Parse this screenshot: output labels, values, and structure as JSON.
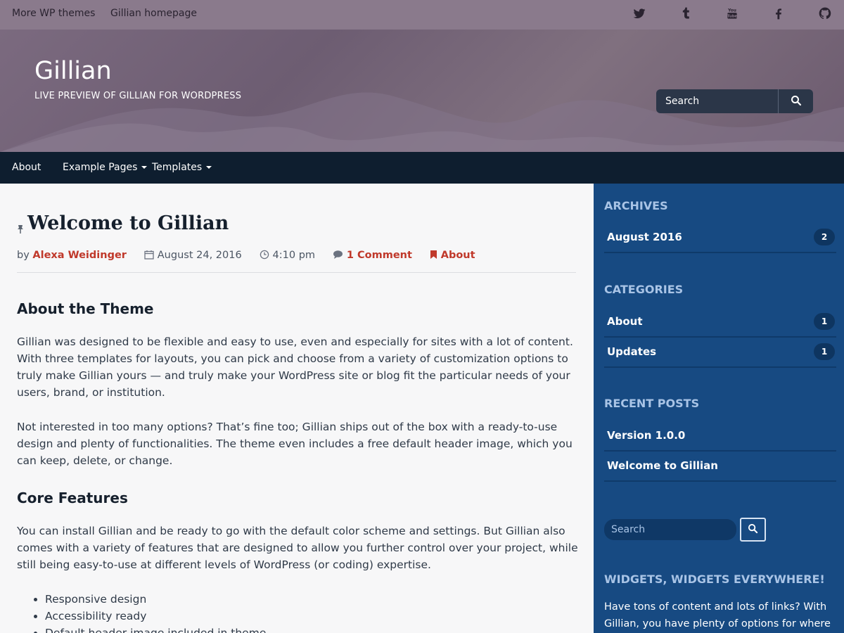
{
  "topbar": {
    "links": [
      "More WP themes",
      "Gillian homepage"
    ],
    "social_icons": [
      "twitter-icon",
      "tumblr-icon",
      "youtube-icon",
      "facebook-icon",
      "github-icon"
    ]
  },
  "header": {
    "site_title": "Gillian",
    "site_description": "LIVE PREVIEW OF GILLIAN FOR WORDPRESS",
    "search_placeholder": "Search"
  },
  "nav": {
    "items": [
      {
        "label": "About",
        "has_dropdown": false
      },
      {
        "label": "Example Pages",
        "has_dropdown": true
      },
      {
        "label": "Templates",
        "has_dropdown": true
      }
    ]
  },
  "post": {
    "title": "Welcome to Gillian",
    "meta": {
      "by": "by",
      "author": "Alexa Weidinger",
      "date": "August 24, 2016",
      "time": "4:10 pm",
      "comments": "1 Comment",
      "category": "About"
    },
    "sections": [
      {
        "heading": "About the Theme",
        "paragraphs": [
          "Gillian was designed to be flexible and easy to use, even and especially for sites with a lot of content. With three templates for layouts, you can pick and choose from a variety of customization options to truly make Gillian yours — and truly make your WordPress site or blog fit the particular needs of your users, brand, or institution.",
          "Not interested in too many options? That’s fine too; Gillian ships out of the box with a ready-to-use design and plenty of functionalities. The theme even includes a free default header image, which you can keep, delete, or change."
        ]
      },
      {
        "heading": "Core Features",
        "paragraphs": [
          "You can install Gillian and be ready to go with the default color scheme and settings. But Gillian also comes with a variety of features that are designed to allow you further control over your project, while still being easy-to-use at different levels of WordPress (or coding) expertise."
        ],
        "list": [
          "Responsive design",
          "Accessibility ready",
          "Default header image included in theme"
        ]
      }
    ]
  },
  "sidebar": {
    "archives": {
      "title": "ARCHIVES",
      "items": [
        {
          "label": "August 2016",
          "count": "2"
        }
      ]
    },
    "categories": {
      "title": "CATEGORIES",
      "items": [
        {
          "label": "About",
          "count": "1"
        },
        {
          "label": "Updates",
          "count": "1"
        }
      ]
    },
    "recent_posts": {
      "title": "RECENT POSTS",
      "items": [
        "Version 1.0.0",
        "Welcome to Gillian"
      ]
    },
    "search_placeholder": "Search",
    "widgets": {
      "title": "WIDGETS, WIDGETS EVERYWHERE!",
      "text": "Have tons of content and lots of links? With Gillian, you have plenty of options for where to"
    }
  },
  "colors": {
    "topbar_bg": "#8a7a8c",
    "nav_bg": "#0e1e2f",
    "sidebar_bg": "#174a82",
    "accent_red": "#c0392b",
    "sidebar_heading": "#a9c4e6"
  }
}
